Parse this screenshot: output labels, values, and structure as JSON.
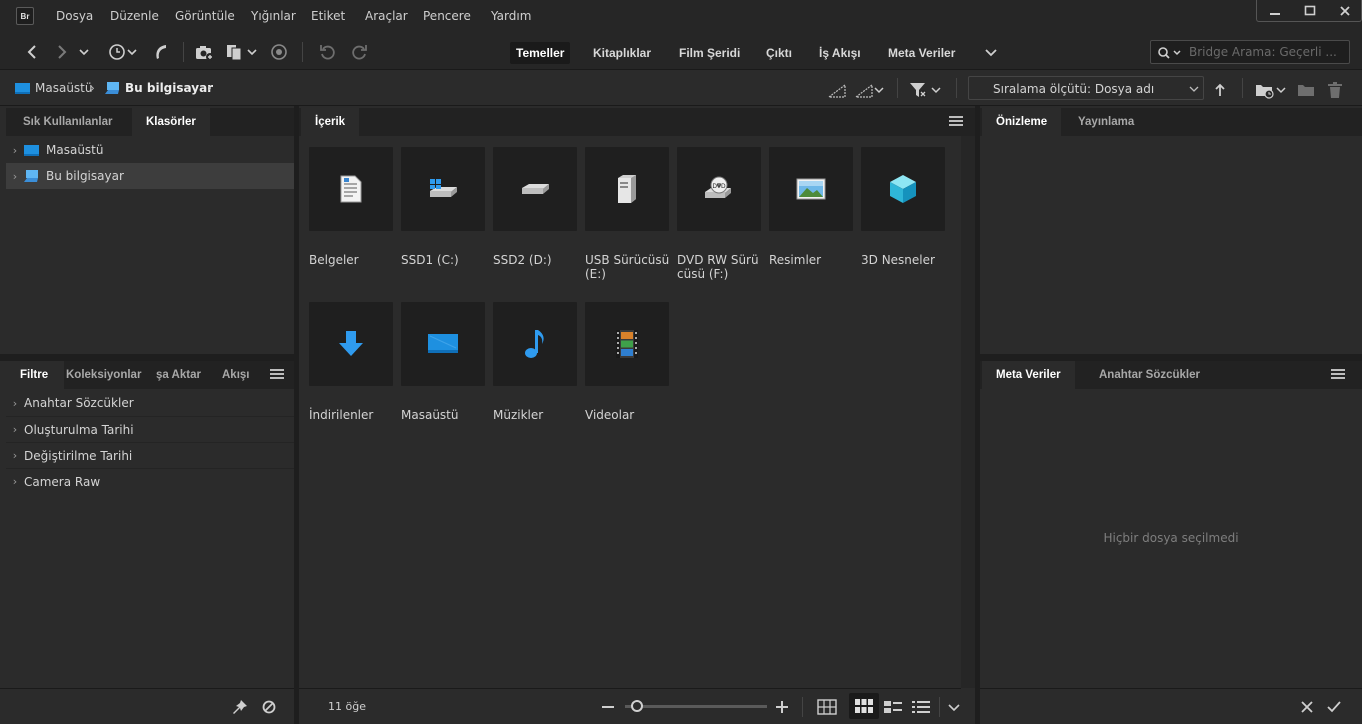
{
  "app": {
    "logo": "Br"
  },
  "menu": [
    "Dosya",
    "Düzenle",
    "Görüntüle",
    "Yığınlar",
    "Etiket",
    "Araçlar",
    "Pencere",
    "Yardım"
  ],
  "workspaces": [
    {
      "label": "Temeller",
      "active": true
    },
    {
      "label": "Kitaplıklar",
      "active": false
    },
    {
      "label": "Film Şeridi",
      "active": false
    },
    {
      "label": "Çıktı",
      "active": false
    },
    {
      "label": "İş Akışı",
      "active": false
    },
    {
      "label": "Meta Veriler",
      "active": false
    }
  ],
  "search": {
    "placeholder": "Bridge Arama: Geçerli ..."
  },
  "path": {
    "crumb1": "Masaüstü",
    "crumb2": "Bu bilgisayar"
  },
  "sort": {
    "label": "Sıralama ölçütü: Dosya adı"
  },
  "left_top_tabs": [
    "Sık Kullanılanlar",
    "Klasörler"
  ],
  "folders": [
    {
      "label": "Masaüstü",
      "selected": false
    },
    {
      "label": "Bu bilgisayar",
      "selected": true
    }
  ],
  "left_bottom_tabs": [
    "Filtre",
    "Koleksiyonlar",
    "şa Aktar",
    "Akışı"
  ],
  "filters": [
    "Anahtar Sözcükler",
    "Oluşturulma Tarihi",
    "Değiştirilme Tarihi",
    "Camera Raw"
  ],
  "content_tab": "İçerik",
  "items": [
    {
      "label": "Belgeler",
      "icon": "document-icon"
    },
    {
      "label": "SSD1 (C:)",
      "icon": "windows-drive-icon"
    },
    {
      "label": "SSD2 (D:)",
      "icon": "drive-icon"
    },
    {
      "label": "USB Sürücüsü (E:)",
      "icon": "usb-drive-icon"
    },
    {
      "label": "DVD RW Sürü cüsü (F:)",
      "icon": "dvd-drive-icon"
    },
    {
      "label": "Resimler",
      "icon": "pictures-icon"
    },
    {
      "label": "3D Nesneler",
      "icon": "3d-objects-icon"
    },
    {
      "label": "İndirilenler",
      "icon": "downloads-icon"
    },
    {
      "label": "Masaüstü",
      "icon": "desktop-icon"
    },
    {
      "label": "Müzikler",
      "icon": "music-icon"
    },
    {
      "label": "Videolar",
      "icon": "videos-icon"
    }
  ],
  "dvd_text": "DVD",
  "status": {
    "count": "11 öğe"
  },
  "right_top_tabs": [
    "Önizleme",
    "Yayınlama"
  ],
  "right_bottom_tabs": [
    "Meta Veriler",
    "Anahtar Sözcükler"
  ],
  "metadata": {
    "empty": "Hiçbir dosya seçilmedi"
  },
  "colors": {
    "accent_blue": "#2f9bef",
    "folder_blue": "#1e90e0"
  }
}
